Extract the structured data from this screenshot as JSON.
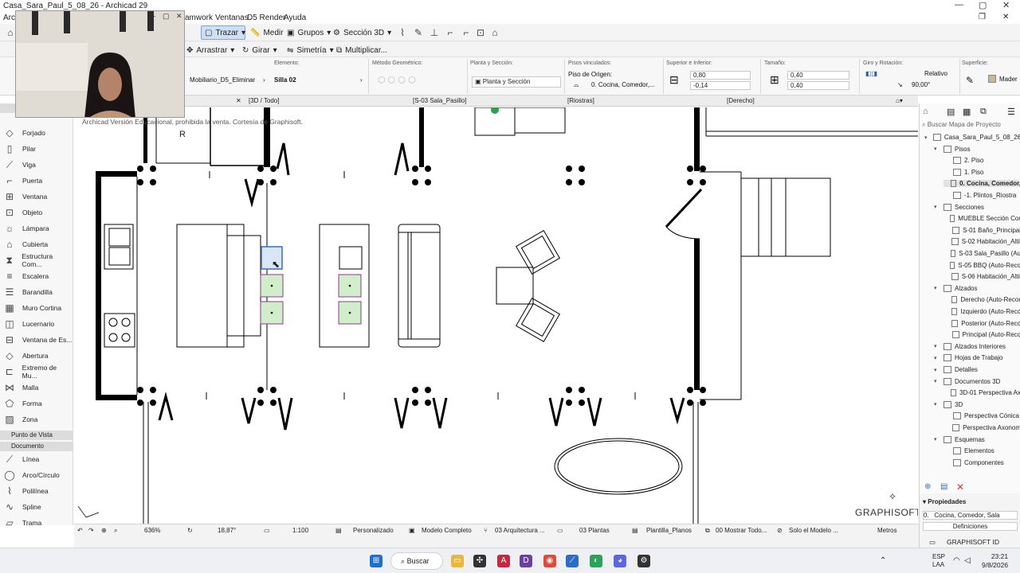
{
  "window": {
    "title": "Casa_Sara_Paul_5_08_26 - Archicad 29"
  },
  "menu": {
    "items": [
      "Arch",
      "amwork",
      "Ventanas",
      "D5 Render",
      "Ayuda"
    ]
  },
  "toolbar": {
    "trazar": "Trazar",
    "medir": "Medir",
    "grupos": "Grupos",
    "seccion3d": "Sección 3D",
    "arrastrar": "Arrastrar",
    "girar": "Girar",
    "simetria": "Simetría",
    "multiplicar": "Multiplicar..."
  },
  "infobox": {
    "elemento_label": "Elemento:",
    "elemento_value": "Mobiliario_D5_Eliminar",
    "element_name": "Silla 02",
    "metodo_label": "Método Geométrico:",
    "planta_label": "Planta y Sección:",
    "planta_value": "Planta y Sección",
    "pisos_label": "Pisos vinculados:",
    "piso_origen_label": "Piso de Origen:",
    "piso_origen_value": "0. Cocina, Comedor,...",
    "sup_inf_label": "Superior e Inferior:",
    "sup_value": "0,80",
    "inf_value": "-0,14",
    "tamano_label": "Tamaño:",
    "size_x": "0,40",
    "size_y": "0,40",
    "giro_label": "Giro y Rotación:",
    "relativo": "Relativo",
    "angle": "90,00°",
    "superficie_label": "Superficie:",
    "superficie_value": "Mader"
  },
  "tabs": [
    "[3D / Todo]",
    "[S-03 Sala_Pasillo]",
    "[Riostras]",
    "[Derecho]"
  ],
  "toolbox": {
    "tools": [
      "Forjado",
      "Pilar",
      "Viga",
      "Puerta",
      "Ventana",
      "Objeto",
      "Lámpara",
      "Cubierta",
      "Estructura Com...",
      "Escalera",
      "Barandilla",
      "Muro Cortina",
      "Lucernario",
      "Ventana de Es...",
      "Abertura",
      "Extremo de Mu...",
      "Malla",
      "Forma",
      "Zona"
    ],
    "section_view": "Punto de Vista",
    "section_doc": "Documento",
    "doc_tools": [
      "Línea",
      "Arco/Círculo",
      "Polilínea",
      "Spline",
      "Trama"
    ]
  },
  "canvas": {
    "watermark": "Archicad Versión Educacional, prohibida la venta. Cortesía de Graphisoft.",
    "letter_r": "R",
    "brand": "GRAPHISOFT"
  },
  "navigator": {
    "search_placeholder": "Buscar Mapa de Proyecto",
    "items": [
      {
        "label": "Casa_Sara_Paul_5_08_26",
        "indent": 0
      },
      {
        "label": "Pisos",
        "indent": 1
      },
      {
        "label": "2. Piso",
        "indent": 2
      },
      {
        "label": "1. Piso",
        "indent": 2
      },
      {
        "label": "0. Cocina, Comedor,",
        "indent": 2,
        "selected": true
      },
      {
        "label": "-1. Plintos_Riostra",
        "indent": 2
      },
      {
        "label": "Secciones",
        "indent": 1
      },
      {
        "label": "MUEBLE Sección Cor",
        "indent": 2
      },
      {
        "label": "S-01 Baño_Principal",
        "indent": 2
      },
      {
        "label": "S-02 Habitación_Altil",
        "indent": 2
      },
      {
        "label": "S-03 Sala_Pasillo (Au",
        "indent": 2
      },
      {
        "label": "S-05 BBQ (Auto-Reco",
        "indent": 2
      },
      {
        "label": "S-06 Habitación_Altil",
        "indent": 2
      },
      {
        "label": "Alzados",
        "indent": 1
      },
      {
        "label": "Derecho (Auto-Recor",
        "indent": 2
      },
      {
        "label": "Izquierdo (Auto-Reco",
        "indent": 2
      },
      {
        "label": "Posterior (Auto-Reco",
        "indent": 2
      },
      {
        "label": "Principal (Auto-Reco",
        "indent": 2
      },
      {
        "label": "Alzados Interiores",
        "indent": 1
      },
      {
        "label": "Hojas de Trabajo",
        "indent": 1
      },
      {
        "label": "Detalles",
        "indent": 1
      },
      {
        "label": "Documentos 3D",
        "indent": 1
      },
      {
        "label": "3D-01 Perspectiva Ax",
        "indent": 2
      },
      {
        "label": "3D",
        "indent": 1
      },
      {
        "label": "Perspectiva Cónica",
        "indent": 2
      },
      {
        "label": "Perspectiva Axonom",
        "indent": 2
      },
      {
        "label": "Esquemas",
        "indent": 1
      },
      {
        "label": "Elementos",
        "indent": 2
      },
      {
        "label": "Componentes",
        "indent": 2
      }
    ]
  },
  "properties": {
    "header": "Propiedades",
    "id": "0.",
    "value": "Cocina, Comedor, Sala",
    "definiciones": "Definiciones",
    "graphisoft_id": "GRAPHISOFT ID"
  },
  "statusbar": {
    "zoom": "636%",
    "angle": "18,87°",
    "scale": "1:100",
    "pen": "Personalizado",
    "model": "Modelo Completo",
    "layer": "03 Arquitectura ...",
    "plantas": "03 Plantas",
    "plantilla": "Plantilla_Planos",
    "mostrar": "00 Mostrar Todo...",
    "solo": "Solo el Modelo ...",
    "units": "Metros"
  },
  "taskbar": {
    "search": "Buscar",
    "lang1": "ESP",
    "lang2": "LAA",
    "time": "23:21",
    "date": "9/8/2026"
  }
}
